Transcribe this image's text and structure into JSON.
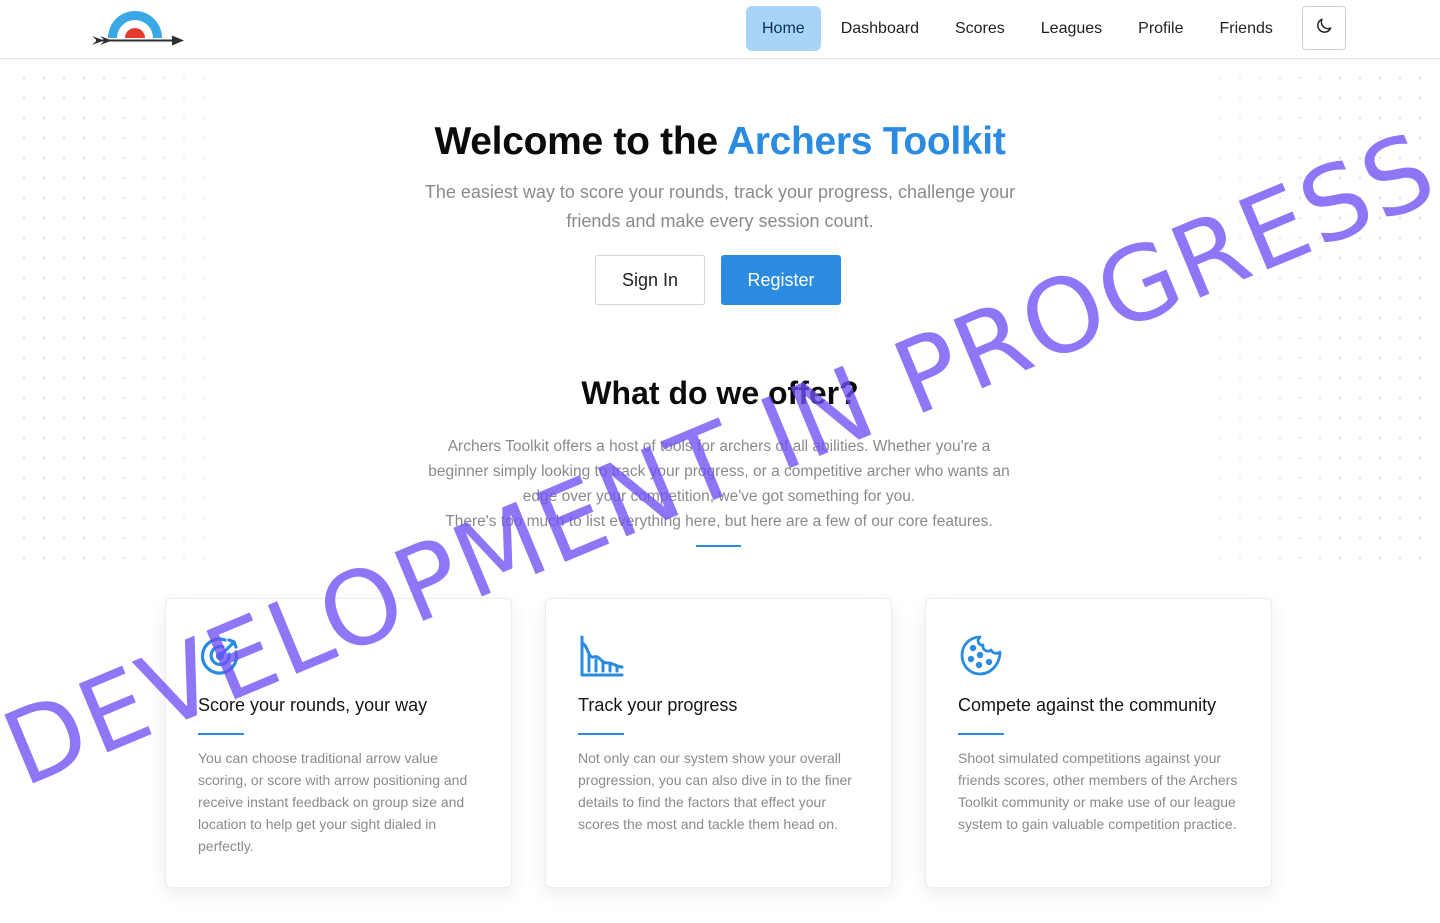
{
  "nav": {
    "items": [
      {
        "label": "Home",
        "active": true
      },
      {
        "label": "Dashboard"
      },
      {
        "label": "Scores"
      },
      {
        "label": "Leagues"
      },
      {
        "label": "Profile"
      },
      {
        "label": "Friends"
      }
    ],
    "theme_toggle_icon": "moon-icon"
  },
  "hero": {
    "title_prefix": "Welcome to the",
    "title_accent": "Archers Toolkit",
    "subtitle": "The easiest way to score your rounds, track your progress, challenge your friends and make every session count.",
    "signin_label": "Sign In",
    "register_label": "Register"
  },
  "offer": {
    "title": "What do we offer?",
    "text_1": "Archers Toolkit offers a host of tools for archers of all abilities. Whether you're a beginner simply looking to track your progress, or a competitive archer who wants an edge over your competition, we've got something for you.",
    "text_2": "There's too much to list everything here, but here are a few of our core features."
  },
  "cards": [
    {
      "icon": "target-arrow-icon",
      "title": "Score your rounds, your way",
      "text": "You can choose traditional arrow value scoring, or score with arrow positioning and receive instant feedback on group size and location to help get your sight dialed in perfectly."
    },
    {
      "icon": "chart-area-icon",
      "title": "Track your progress",
      "text": "Not only can our system show your overall progression, you can also dive in to the finer details to find the factors that effect your scores the most and tackle them head on."
    },
    {
      "icon": "cookie-icon",
      "title": "Compete against the community",
      "text": "Shoot simulated competitions against your friends scores, other members of the Archers Toolkit community or make use of our league system to gain valuable competition practice."
    }
  ],
  "watermark": "DEVELOPMENT IN PROGRESS",
  "colors": {
    "accent": "#2a8be0",
    "nav_active": "#a7d4f7",
    "watermark": "#6e50f5"
  }
}
